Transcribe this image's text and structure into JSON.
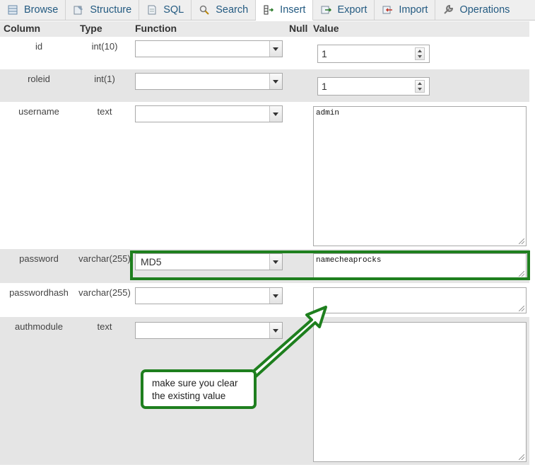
{
  "tabs": [
    {
      "label": "Browse",
      "icon": "browse-icon",
      "active": false
    },
    {
      "label": "Structure",
      "icon": "structure-icon",
      "active": false
    },
    {
      "label": "SQL",
      "icon": "sql-icon",
      "active": false
    },
    {
      "label": "Search",
      "icon": "search-icon",
      "active": false
    },
    {
      "label": "Insert",
      "icon": "insert-icon",
      "active": true
    },
    {
      "label": "Export",
      "icon": "export-icon",
      "active": false
    },
    {
      "label": "Import",
      "icon": "import-icon",
      "active": false
    },
    {
      "label": "Operations",
      "icon": "operations-icon",
      "active": false
    }
  ],
  "header": {
    "column": "Column",
    "type": "Type",
    "function": "Function",
    "null": "Null",
    "value": "Value"
  },
  "rows": [
    {
      "name": "id",
      "type": "int(10)",
      "function": "",
      "value": "1"
    },
    {
      "name": "roleid",
      "type": "int(1)",
      "function": "",
      "value": "1"
    },
    {
      "name": "username",
      "type": "text",
      "function": "",
      "value": "admin"
    },
    {
      "name": "password",
      "type": "varchar(255)",
      "function": "MD5",
      "value": "namecheaprocks"
    },
    {
      "name": "passwordhash",
      "type": "varchar(255)",
      "function": "",
      "value": ""
    },
    {
      "name": "authmodule",
      "type": "text",
      "function": "",
      "value": ""
    }
  ],
  "callout": {
    "line1": "make sure you clear",
    "line2": "the existing value"
  },
  "colors": {
    "accent_green": "#1e7f1e",
    "tab_text": "#235a81",
    "row_alt": "#e5e5e5"
  }
}
